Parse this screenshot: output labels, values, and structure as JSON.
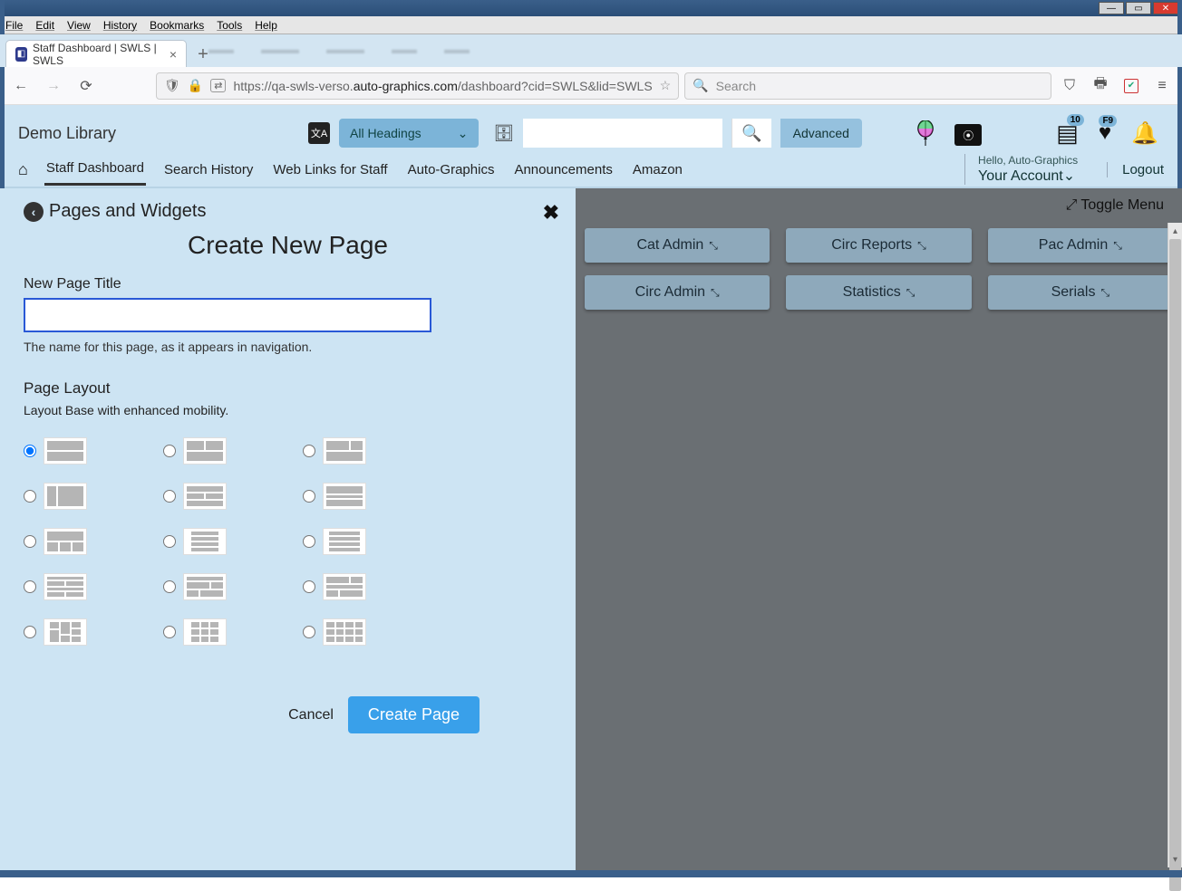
{
  "os": {
    "menubar": [
      "File",
      "Edit",
      "View",
      "History",
      "Bookmarks",
      "Tools",
      "Help"
    ]
  },
  "browser": {
    "tab_title": "Staff Dashboard | SWLS | SWLS",
    "url_prefix": "https://qa-swls-verso.",
    "url_bold": "auto-graphics.com",
    "url_suffix": "/dashboard?cid=SWLS&lid=SWLS",
    "search_placeholder": "Search"
  },
  "header": {
    "library_name": "Demo Library",
    "heading_filter": "All Headings",
    "advanced": "Advanced",
    "badge_list": "10",
    "badge_heart": "F9"
  },
  "nav": {
    "items": [
      "Staff Dashboard",
      "Search History",
      "Web Links for Staff",
      "Auto-Graphics",
      "Announcements",
      "Amazon"
    ],
    "hello": "Hello, Auto-Graphics",
    "account": "Your Account",
    "logout": "Logout"
  },
  "panel": {
    "breadcrumb": "Pages and Widgets",
    "title": "Create New Page",
    "label_title": "New Page Title",
    "help_title": "The name for this page, as it appears in navigation.",
    "label_layout": "Page Layout",
    "sub_layout": "Layout Base with enhanced mobility.",
    "cancel": "Cancel",
    "create": "Create Page"
  },
  "right": {
    "toggle": "Toggle Menu",
    "buttons_row1": [
      "Cat Admin",
      "Circ Reports",
      "Pac Admin"
    ],
    "buttons_row2": [
      "Circ Admin",
      "Statistics",
      "Serials"
    ]
  }
}
